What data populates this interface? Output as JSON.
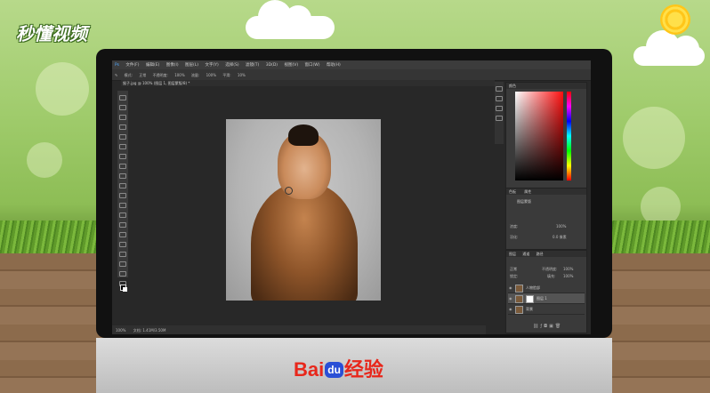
{
  "watermark": {
    "brand": "秒懂视频",
    "logo_text": "Bai du 经验",
    "logo_bai": "Bai",
    "logo_du": "du",
    "logo_jy": "经验"
  },
  "colors": {
    "photoshop_bg": "#282828",
    "panel_bg": "#3a3a3a",
    "baidu_red": "#e8271b",
    "baidu_blue": "#2a4fd6"
  },
  "photoshop": {
    "menu": [
      "文件(F)",
      "编辑(E)",
      "图像(I)",
      "图层(L)",
      "文字(Y)",
      "选择(S)",
      "滤镜(T)",
      "3D(D)",
      "视图(V)",
      "窗口(W)",
      "帮助(H)"
    ],
    "options": {
      "mode_label": "模式:",
      "mode_value": "正常",
      "opacity_label": "不透明度:",
      "opacity_value": "100%",
      "flow_label": "流量:",
      "flow_value": "100%",
      "smooth_label": "平滑:",
      "smooth_value": "10%"
    },
    "document_tab": "猴子.jpg @ 100% (图层 1, 图层蒙版/8) *",
    "status": {
      "zoom": "100%",
      "doc_info": "文档: 1.41M/3.50M"
    },
    "panels": {
      "color_tab": "颜色",
      "swatch_tab": "色板",
      "properties_tab": "属性",
      "properties_sub": "图层蒙版",
      "density_label": "浓度:",
      "density_value": "100%",
      "feather_label": "羽化:",
      "feather_value": "0.0 像素",
      "layers_tab": "图层",
      "channels_tab": "通道",
      "paths_tab": "路径",
      "blend_mode": "正常",
      "opacity_label": "不透明度:",
      "opacity_value": "100%",
      "lock_label": "锁定:",
      "fill_label": "填充:",
      "fill_value": "100%",
      "layers": [
        {
          "name": "人物脸部",
          "selected": false
        },
        {
          "name": "图层 1",
          "selected": true
        },
        {
          "name": "背景",
          "selected": false
        }
      ]
    }
  }
}
